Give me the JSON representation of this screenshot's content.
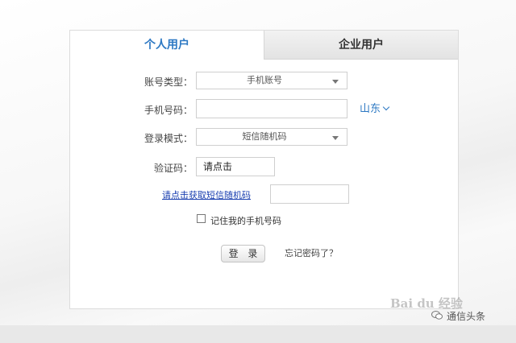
{
  "tabs": {
    "personal": "个人用户",
    "enterprise": "企业用户"
  },
  "form": {
    "account_type": {
      "label": "账号类型：",
      "value": "手机账号"
    },
    "phone": {
      "label": "手机号码：",
      "value": ""
    },
    "region": "山东",
    "login_mode": {
      "label": "登录模式：",
      "value": "短信随机码"
    },
    "captcha": {
      "label": "验证码：",
      "value": "请点击"
    },
    "sms_link": "请点击获取短信随机码",
    "sms_code_value": "",
    "remember": {
      "label": "记住我的手机号码",
      "checked": false
    },
    "login_button": "登 录",
    "forgot_link": "忘记密码了？"
  },
  "watermark": "Bai du 经验",
  "source_tag": "通信头条",
  "colors": {
    "accent": "#2c78c3",
    "link": "#1a3fb0"
  }
}
